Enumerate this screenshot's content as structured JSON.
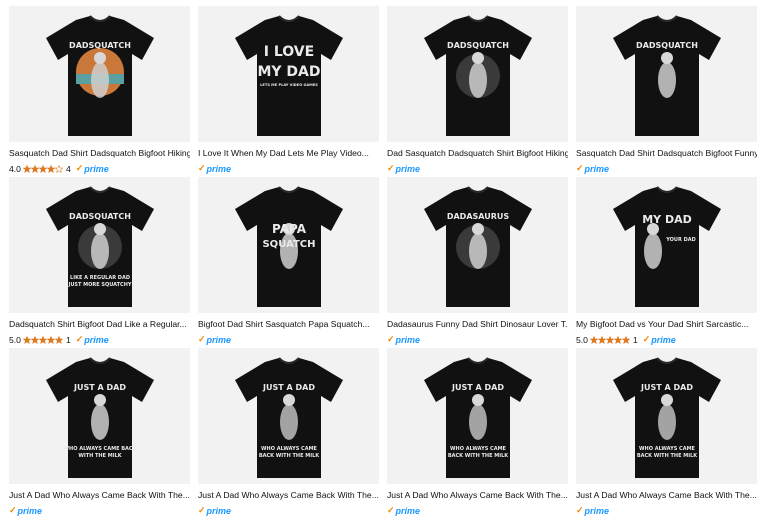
{
  "products": [
    {
      "title": "Sasquatch Dad Shirt Dadsquatch Bigfoot Hiking...",
      "rating": "4.0",
      "stars": 4,
      "count": "4",
      "prime": "prime",
      "art": {
        "line1": "DADSQUATCH",
        "line2": "",
        "line3": "",
        "style": "sunset"
      }
    },
    {
      "title": "I Love It When My Dad Lets Me Play Video...",
      "rating": "",
      "stars": 0,
      "count": "",
      "prime": "prime",
      "art": {
        "line1": "I LOVE",
        "line2": "MY DAD",
        "line3": "LETS ME PLAY VIDEO GAMES",
        "style": "text"
      }
    },
    {
      "title": "Dad Sasquatch Dadsquatch Shirt Bigfoot Hiking...",
      "rating": "",
      "stars": 0,
      "count": "",
      "prime": "prime",
      "art": {
        "line1": "DADSQUATCH",
        "line2": "",
        "line3": "",
        "style": "forest"
      }
    },
    {
      "title": "Sasquatch Dad Shirt Dadsquatch Bigfoot Funny...",
      "rating": "",
      "stars": 0,
      "count": "",
      "prime": "prime",
      "art": {
        "line1": "DADSQUATCH",
        "line2": "",
        "line3": "",
        "style": "figure"
      }
    },
    {
      "title": "Dadsquatch Shirt Bigfoot Dad Like a Regular...",
      "rating": "5.0",
      "stars": 5,
      "count": "1",
      "prime": "prime",
      "art": {
        "line1": "DADSQUATCH",
        "line2": "LIKE A REGULAR DAD",
        "line3": "JUST MORE SQUATCHY",
        "style": "forest"
      }
    },
    {
      "title": "Bigfoot Dad Shirt Sasquatch Papa Squatch...",
      "rating": "",
      "stars": 0,
      "count": "",
      "prime": "prime",
      "art": {
        "line1": "PAPA",
        "line2": "SQUATCH",
        "line3": "",
        "style": "papa"
      }
    },
    {
      "title": "Dadasaurus Funny Dad Shirt Dinosaur Lover T...",
      "rating": "",
      "stars": 0,
      "count": "",
      "prime": "prime",
      "art": {
        "line1": "DADASAURUS",
        "line2": "",
        "line3": "",
        "style": "dino"
      }
    },
    {
      "title": "My Bigfoot Dad vs Your Dad Shirt Sarcastic...",
      "rating": "5.0",
      "stars": 5,
      "count": "1",
      "prime": "prime",
      "art": {
        "line1": "MY DAD",
        "line2": "YOUR DAD",
        "line3": "",
        "style": "vs"
      }
    },
    {
      "title": "Just A Dad Who Always Came Back With The...",
      "rating": "",
      "stars": 0,
      "count": "",
      "prime": "prime",
      "art": {
        "line1": "JUST A DAD",
        "line2": "WHO ALWAYS CAME BACK",
        "line3": "WITH THE MILK",
        "style": "figure"
      }
    },
    {
      "title": "Just A Dad Who Always Came Back With The...",
      "rating": "",
      "stars": 0,
      "count": "",
      "prime": "prime",
      "art": {
        "line1": "JUST A DAD",
        "line2": "WHO ALWAYS CAME",
        "line3": "BACK WITH THE MILK",
        "style": "skeleton"
      }
    },
    {
      "title": "Just A Dad Who Always Came Back With The...",
      "rating": "",
      "stars": 0,
      "count": "",
      "prime": "prime",
      "art": {
        "line1": "JUST A DAD",
        "line2": "WHO ALWAYS CAME",
        "line3": "BACK WITH THE MILK",
        "style": "skeleton"
      }
    },
    {
      "title": "Just A Dad Who Always Came Back With The...",
      "rating": "",
      "stars": 0,
      "count": "",
      "prime": "prime",
      "art": {
        "line1": "JUST A DAD",
        "line2": "WHO ALWAYS CAME",
        "line3": "BACK WITH THE MILK",
        "style": "skeleton"
      }
    }
  ],
  "colors": {
    "star": "#de7921",
    "prime": "#1a98ff",
    "prime_check": "#f08804",
    "thumb_bg": "#f2f2f2",
    "shirt": "#111111"
  }
}
